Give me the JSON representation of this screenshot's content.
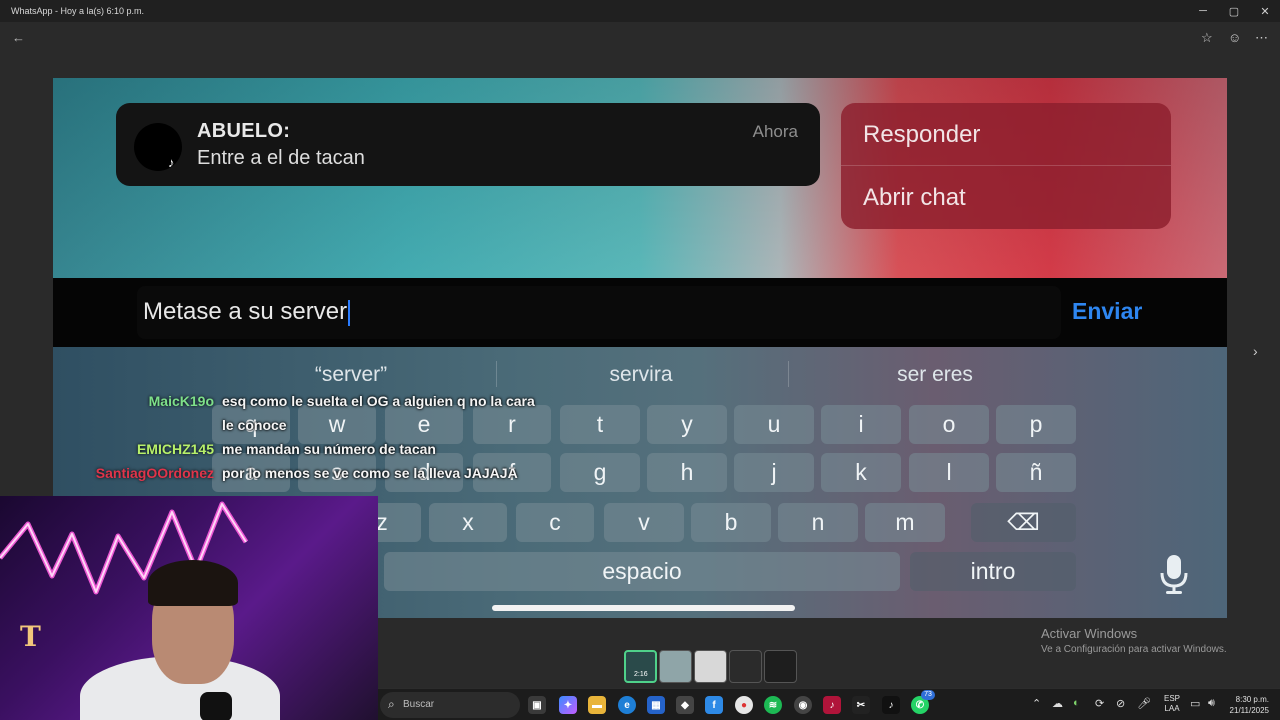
{
  "window": {
    "title": "WhatsApp - Hoy a la(s) 6:10 p.m.",
    "controls": {
      "minimize": "─",
      "maximize": "▢",
      "close": "✕"
    }
  },
  "viewer": {
    "back_icon": "←",
    "star_icon": "☆",
    "emoji_icon": "☺",
    "more_icon": "⋯",
    "next_icon": "›"
  },
  "notification": {
    "sender": "ABUELO:",
    "message": "Entre a el de tacan",
    "time": "Ahora",
    "badge_icon": "♪"
  },
  "actions": {
    "reply": "Responder",
    "open_chat": "Abrir chat"
  },
  "reply_bar": {
    "text": "Metase a su server",
    "send": "Enviar"
  },
  "keyboard": {
    "suggestions": [
      "“server”",
      "servira",
      "ser eres"
    ],
    "row1": [
      "q",
      "w",
      "e",
      "r",
      "t",
      "y",
      "u",
      "i",
      "o",
      "p"
    ],
    "row2": [
      "a",
      "s",
      "d",
      "f",
      "g",
      "h",
      "j",
      "k",
      "l",
      "ñ"
    ],
    "row3": [
      "z",
      "x",
      "c",
      "v",
      "b",
      "n",
      "m"
    ],
    "backspace": "⌫",
    "space": "espacio",
    "enter": "intro"
  },
  "chat": [
    {
      "user": "MaicK19o",
      "color": "#7ee08a",
      "text": "esq como le suelta el OG a alguien q no la cara"
    },
    {
      "user": "",
      "color": "#ffffff",
      "text": "le conoce"
    },
    {
      "user": "EMICHZ145",
      "color": "#b7f06a",
      "text": "me mandan su número de tacan"
    },
    {
      "user": "SantiagOOrdonez",
      "color": "#e0344a",
      "text": "por lo menos se ve como se la lleva JAJAJA"
    }
  ],
  "webcam": {
    "logo": "T"
  },
  "watermark": {
    "line1": "Activar Windows",
    "line2": "Ve a Configuración para activar Windows."
  },
  "thumb_label": "2:16",
  "taskbar": {
    "search_placeholder": "Buscar",
    "search_icon": "⌕",
    "whatsapp_badge": "73",
    "lang_line1": "ESP",
    "lang_line2": "LAA",
    "time": "8:30 p.m.",
    "date": "21/11/2025"
  }
}
